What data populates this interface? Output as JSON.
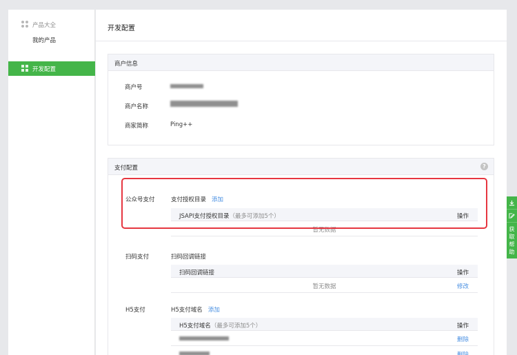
{
  "sidebar": {
    "group_title": "产品大全",
    "group_item": "我的产品",
    "active_item": "开发配置"
  },
  "page_title": "开发配置",
  "merchant": {
    "header": "商户信息",
    "rows": [
      {
        "label": "商户号",
        "value": ""
      },
      {
        "label": "商户名称",
        "value": ""
      },
      {
        "label": "商家简称",
        "value": "Ping++"
      }
    ]
  },
  "payment": {
    "header": "支付配置",
    "help_icon": "?",
    "sections": [
      {
        "label": "公众号支付",
        "title": "支付授权目录",
        "link": "添加",
        "col1": "JSAPI支付授权目录",
        "col1_hint": "（最多可添加5个）",
        "col2": "操作",
        "empty": "暂无数据"
      },
      {
        "label": "扫码支付",
        "title": "扫码回调链接",
        "col1": "扫码回调链接",
        "col2": "操作",
        "empty": "暂无数据",
        "row_action": "修改"
      },
      {
        "label": "H5支付",
        "title": "H5支付域名",
        "link": "添加",
        "col1": "H5支付域名",
        "col1_hint": "（最多可添加5个）",
        "col2": "操作",
        "row_actions": [
          "删除",
          "删除"
        ]
      }
    ]
  },
  "float_bar": {
    "icons": [
      "download-icon",
      "edit-icon"
    ],
    "help_text": [
      "获",
      "取",
      "帮",
      "助"
    ]
  },
  "colors": {
    "accent": "#44b549",
    "link": "#4a90e2",
    "highlight": "#e6353f"
  }
}
